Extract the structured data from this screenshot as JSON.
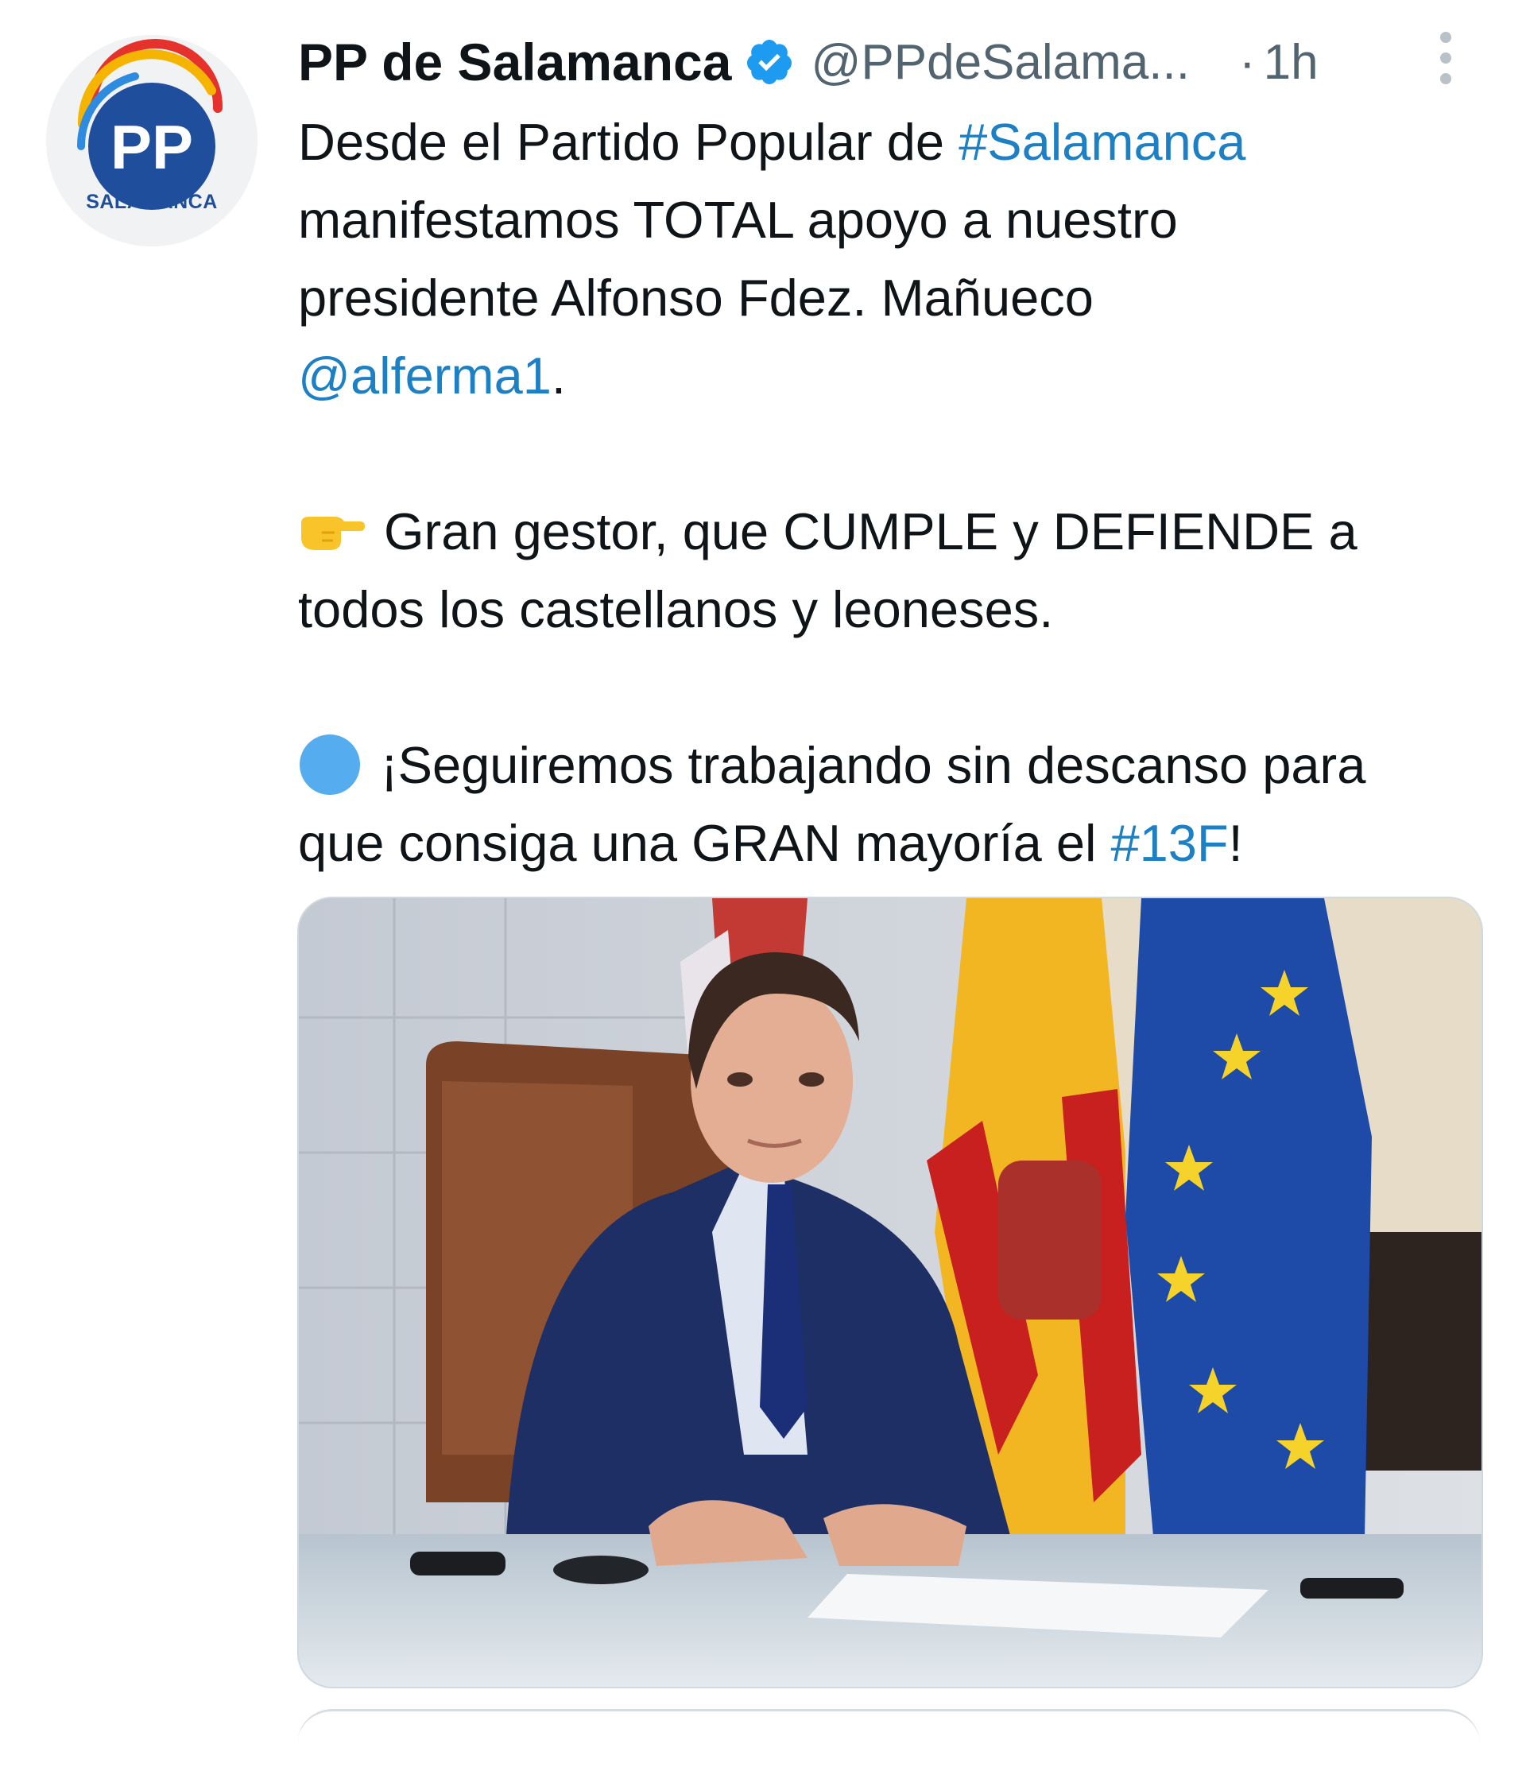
{
  "account": {
    "display_name": "PP de Salamanca",
    "handle": "@PPdeSalama...",
    "separator": "·",
    "time": "1h",
    "avatar_caption": "SALAMANCA",
    "avatar_logo_text": "PP",
    "verified_icon": "verified-badge-icon"
  },
  "tweet": {
    "line1_text": "Desde el Partido Popular de ",
    "line1_hashtag": "#Salamanca",
    "line2": "manifestamos TOTAL apoyo a nuestro",
    "line3": "presidente Alfonso Fdez. Mañueco",
    "mention": "@alferma1",
    "mention_suffix": ".",
    "line5_emoji": "pointing-right-icon",
    "line5": "Gran gestor, que CUMPLE y DEFIENDE a",
    "line6": "todos los castellanos y leoneses.",
    "line7_emoji": "blue-circle-icon",
    "line7": "¡Seguiremos trabajando sin descanso para",
    "line8_text": "que consiga una GRAN mayoría el ",
    "line8_hashtag": "#13F",
    "line8_suffix": "!"
  },
  "colors": {
    "link": "#1d7fc4",
    "verified": "#1d9bf0",
    "muted": "#536471",
    "pp_blue": "#1f4e9c"
  }
}
